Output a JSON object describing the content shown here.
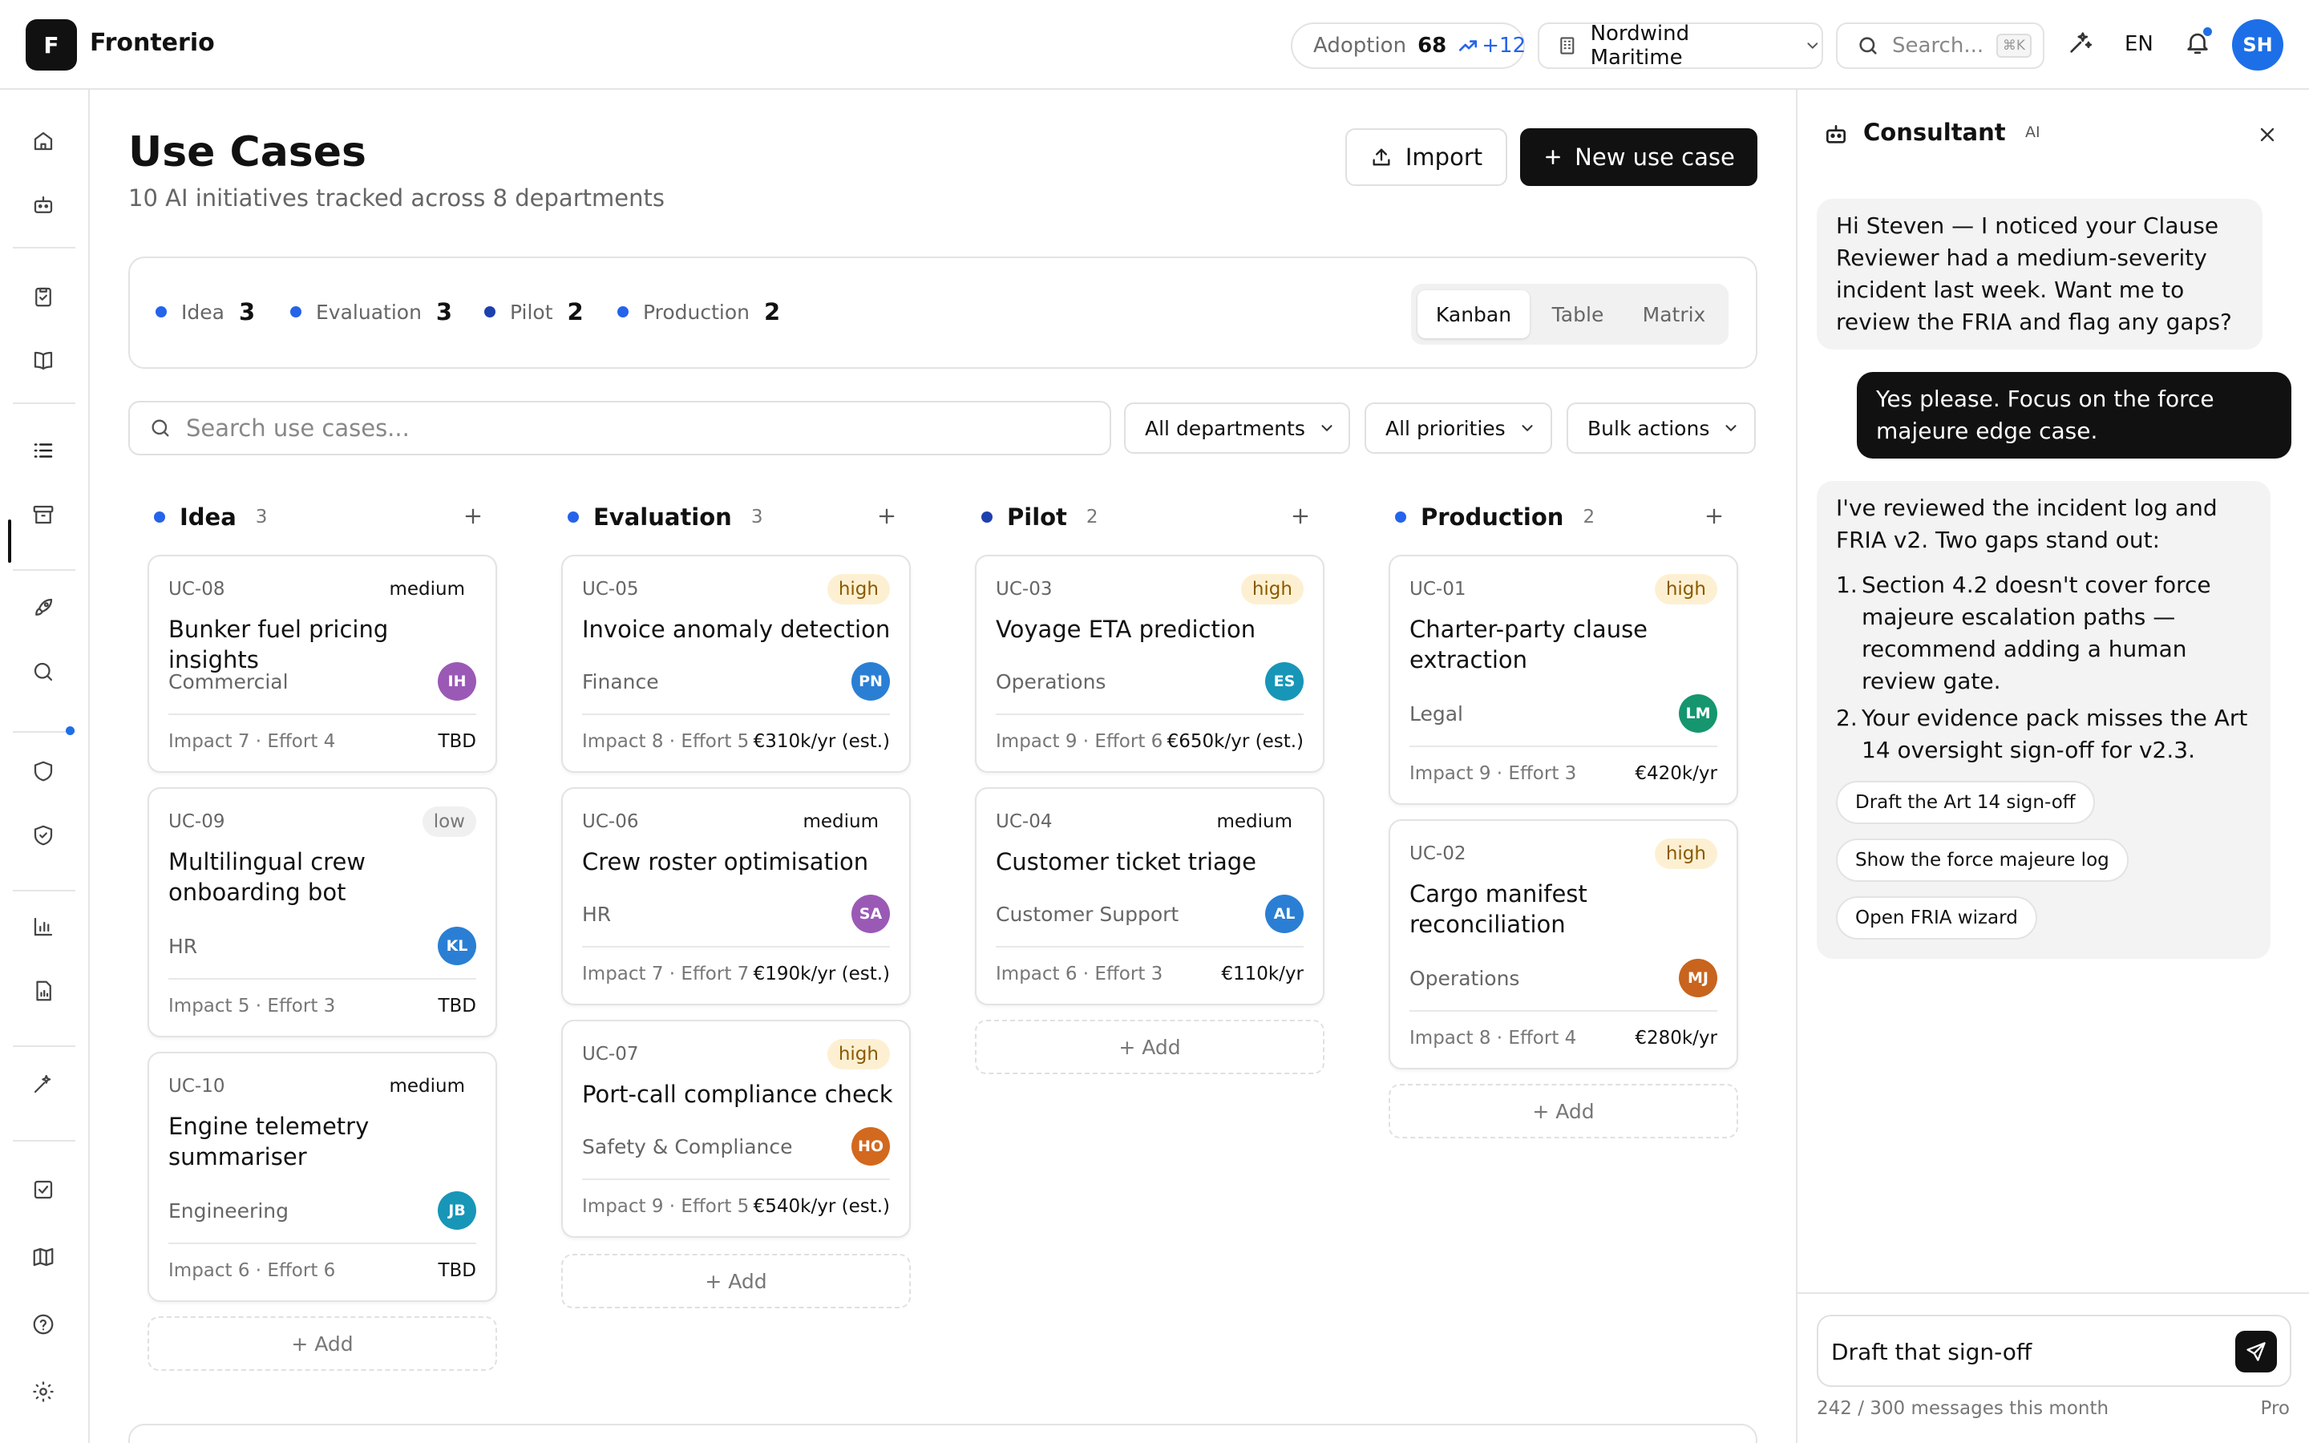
{
  "app": {
    "logo_letter": "F",
    "name": "Fronterio"
  },
  "topbar": {
    "adoption_label": "Adoption",
    "adoption_value": "68",
    "adoption_delta": "+12",
    "org_name": "Nordwind Maritime",
    "search_placeholder": "Search...",
    "search_shortcut": "⌘K",
    "language": "EN",
    "user_initials": "SH"
  },
  "page": {
    "title": "Use Cases",
    "subtitle": "10 AI initiatives tracked across 8 departments",
    "import_label": "Import",
    "new_label": "New use case"
  },
  "stats": [
    {
      "label": "Idea",
      "count": "3"
    },
    {
      "label": "Evaluation",
      "count": "3"
    },
    {
      "label": "Pilot",
      "count": "2"
    },
    {
      "label": "Production",
      "count": "2"
    }
  ],
  "views": [
    "Kanban",
    "Table",
    "Matrix"
  ],
  "active_view": "Kanban",
  "search_placeholder": "Search use cases...",
  "filters": {
    "departments": "All departments",
    "priorities": "All priorities",
    "bulk": "Bulk actions"
  },
  "add_label": "+ Add",
  "columns": [
    {
      "name": "Idea",
      "count": "3",
      "cards": [
        {
          "id": "UC-08",
          "priority": "medium",
          "title": "Bunker fuel pricing insights",
          "dept": "Commercial",
          "initials": "IH",
          "meta": "Impact 7 · Effort 4",
          "value": "TBD"
        },
        {
          "id": "UC-09",
          "priority": "low",
          "title": "Multilingual crew onboarding bot",
          "dept": "HR",
          "initials": "KL",
          "meta": "Impact 5 · Effort 3",
          "value": "TBD"
        },
        {
          "id": "UC-10",
          "priority": "medium",
          "title": "Engine telemetry summariser",
          "dept": "Engineering",
          "initials": "JB",
          "meta": "Impact 6 · Effort 6",
          "value": "TBD"
        }
      ]
    },
    {
      "name": "Evaluation",
      "count": "3",
      "cards": [
        {
          "id": "UC-05",
          "priority": "high",
          "title": "Invoice anomaly detection",
          "dept": "Finance",
          "initials": "PN",
          "meta": "Impact 8 · Effort 5",
          "value": "€310k/yr (est.)"
        },
        {
          "id": "UC-06",
          "priority": "medium",
          "title": "Crew roster optimisation",
          "dept": "HR",
          "initials": "SA",
          "meta": "Impact 7 · Effort 7",
          "value": "€190k/yr (est.)"
        },
        {
          "id": "UC-07",
          "priority": "high",
          "title": "Port-call compliance check",
          "dept": "Safety & Compliance",
          "initials": "HO",
          "meta": "Impact 9 · Effort 5",
          "value": "€540k/yr (est.)"
        }
      ]
    },
    {
      "name": "Pilot",
      "count": "2",
      "cards": [
        {
          "id": "UC-03",
          "priority": "high",
          "title": "Voyage ETA prediction",
          "dept": "Operations",
          "initials": "ES",
          "meta": "Impact 9 · Effort 6",
          "value": "€650k/yr (est.)"
        },
        {
          "id": "UC-04",
          "priority": "medium",
          "title": "Customer ticket triage",
          "dept": "Customer Support",
          "initials": "AL",
          "meta": "Impact 6 · Effort 3",
          "value": "€110k/yr"
        }
      ]
    },
    {
      "name": "Production",
      "count": "2",
      "cards": [
        {
          "id": "UC-01",
          "priority": "high",
          "title": "Charter-party clause extraction",
          "dept": "Legal",
          "initials": "LM",
          "meta": "Impact 9 · Effort 3",
          "value": "€420k/yr"
        },
        {
          "id": "UC-02",
          "priority": "high",
          "title": "Cargo manifest reconciliation",
          "dept": "Operations",
          "initials": "MJ",
          "meta": "Impact 8 · Effort 4",
          "value": "€280k/yr"
        }
      ]
    }
  ],
  "consultant": {
    "title": "Consultant",
    "badge": "AI",
    "msg1": "Hi Steven — I noticed your Clause Reviewer had a medium-severity incident last week. Want me to review the FRIA and flag any gaps?",
    "msg2": "Yes please. Focus on the force majeure edge case.",
    "msg3_intro": "I've reviewed the incident log and FRIA v2. Two gaps stand out:",
    "msg3_points": [
      "Section 4.2 doesn't cover force majeure escalation paths — recommend adding a human review gate.",
      "Your evidence pack misses the Art 14 oversight sign-off for v2.3."
    ],
    "chips": [
      "Draft the Art 14 sign-off",
      "Show the force majeure log",
      "Open FRIA wizard"
    ],
    "input_value": "Draft that sign-off",
    "quota": "242 / 300 messages this month",
    "plan": "Pro"
  },
  "colors": {
    "accent": "#1d6fe8",
    "idea": "#2563eb",
    "evaluation": "#2563eb",
    "pilot": "#1e40af",
    "production": "#2563eb",
    "high_bg": "#fdf0d2",
    "avatars": {
      "IH": "#9b59b6",
      "KL": "#2a7fd4",
      "JB": "#1796b8",
      "PN": "#2a7fd4",
      "SA": "#9b59b6",
      "HO": "#d2691e",
      "ES": "#1796b8",
      "AL": "#2a7fd4",
      "LM": "#15966e",
      "MJ": "#c8641e"
    }
  }
}
